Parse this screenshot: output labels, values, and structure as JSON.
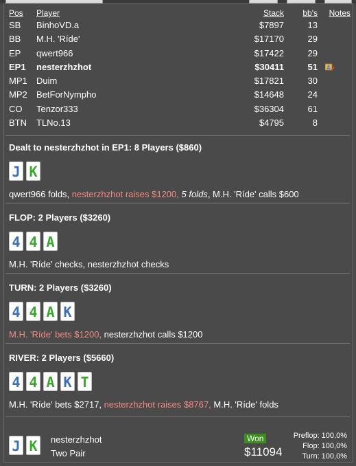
{
  "colors": {
    "background": "#4a4a4a",
    "raise_text": "#f08c84",
    "won_badge": "#3c8c1e",
    "card_spade": "#3a6fb5",
    "card_club": "#3aa62e"
  },
  "headers": {
    "pos": "Pos",
    "player": "Player",
    "stack": "Stack",
    "bbs": "bb's",
    "notes": "Notes"
  },
  "players": [
    {
      "pos": "SB",
      "name": "BinhoVD.a",
      "stack": "$7897",
      "bbs": "13"
    },
    {
      "pos": "BB",
      "name": "M.H. 'Ríde'",
      "stack": "$17170",
      "bbs": "29"
    },
    {
      "pos": "EP",
      "name": "qwert966",
      "stack": "$17422",
      "bbs": "29"
    },
    {
      "pos": "EP1",
      "name": "nesterzhzhot",
      "stack": "$30411",
      "bbs": "51",
      "hero": true,
      "note_icon": "player-note-icon"
    },
    {
      "pos": "MP1",
      "name": "Duim",
      "stack": "$17821",
      "bbs": "30"
    },
    {
      "pos": "MP2",
      "name": "BetForNympho",
      "stack": "$14648",
      "bbs": "24"
    },
    {
      "pos": "CO",
      "name": "Tenzor333",
      "stack": "$36304",
      "bbs": "61"
    },
    {
      "pos": "BTN",
      "name": "TLNo.13",
      "stack": "$4795",
      "bbs": "8"
    }
  ],
  "streets": {
    "preflop": {
      "title": "Dealt to nesterzhzhot in EP1: 8 Players ($860)",
      "cards": [
        {
          "rank": "J",
          "suit": "spade"
        },
        {
          "rank": "K",
          "suit": "club"
        }
      ],
      "actions": {
        "a1": "qwert966 folds, ",
        "a2": "nesterzhzhot raises $1200, ",
        "a3": "5 folds",
        "a4": ", M.H. 'Ríde' calls $600"
      }
    },
    "flop": {
      "title": "FLOP: 2 Players ($3260)",
      "cards": [
        {
          "rank": "4",
          "suit": "spade"
        },
        {
          "rank": "4",
          "suit": "club"
        },
        {
          "rank": "A",
          "suit": "club"
        }
      ],
      "actions": {
        "a1": "M.H. 'Ríde' checks, nesterzhzhot checks"
      }
    },
    "turn": {
      "title": "TURN: 2 Players ($3260)",
      "cards": [
        {
          "rank": "4",
          "suit": "spade"
        },
        {
          "rank": "4",
          "suit": "club"
        },
        {
          "rank": "A",
          "suit": "club"
        },
        {
          "rank": "K",
          "suit": "spade"
        }
      ],
      "actions": {
        "a1": "M.H. 'Ríde' bets $1200, ",
        "a2": "nesterzhzhot calls $1200"
      }
    },
    "river": {
      "title": "RIVER: 2 Players ($5660)",
      "cards": [
        {
          "rank": "4",
          "suit": "spade"
        },
        {
          "rank": "4",
          "suit": "club"
        },
        {
          "rank": "A",
          "suit": "club"
        },
        {
          "rank": "K",
          "suit": "spade"
        },
        {
          "rank": "T",
          "suit": "club"
        }
      ],
      "actions": {
        "a1": "M.H. 'Ríde' bets $2717, ",
        "a2": "nesterzhzhot raises $8767, ",
        "a3": "M.H. 'Ríde' folds"
      }
    }
  },
  "result": {
    "cards": [
      {
        "rank": "J",
        "suit": "spade"
      },
      {
        "rank": "K",
        "suit": "club"
      }
    ],
    "player": "nesterzhzhot",
    "hand": "Two Pair",
    "won_label": "Won",
    "amount": "$11094",
    "equity": {
      "preflop": "Preflop: 100,0%",
      "flop": "Flop: 100,0%",
      "turn": "Turn: 100,0%"
    }
  }
}
